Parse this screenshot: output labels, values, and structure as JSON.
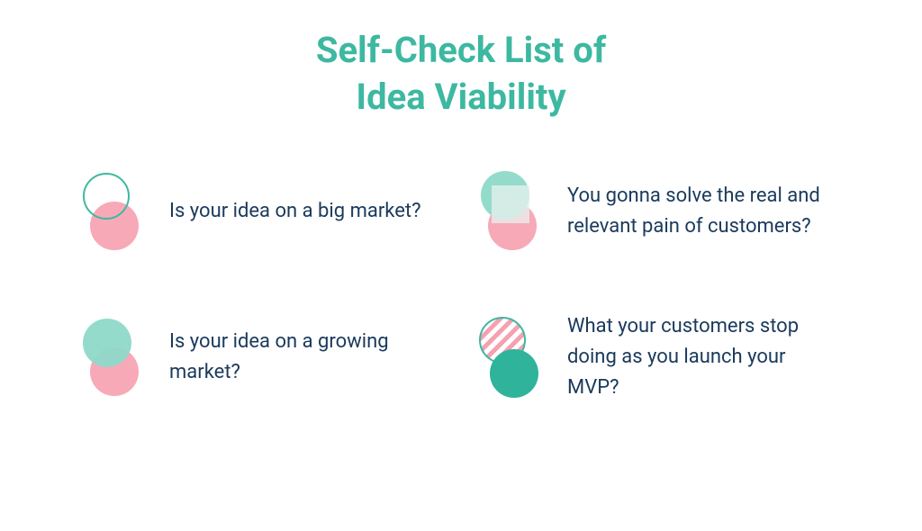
{
  "title_line1": "Self-Check List of",
  "title_line2": "Idea Viability",
  "items": [
    {
      "text": "Is your idea on a big market?"
    },
    {
      "text": "You gonna solve the real and relevant pain of customers?"
    },
    {
      "text": "Is your idea on a growing market?"
    },
    {
      "text": "What your customers stop doing as you launch your MVP?"
    }
  ],
  "colors": {
    "accent_teal": "#3db8a1",
    "soft_teal": "#8ed9c9",
    "soft_pink": "#f6a0b0",
    "text_navy": "#1a3a5c"
  }
}
